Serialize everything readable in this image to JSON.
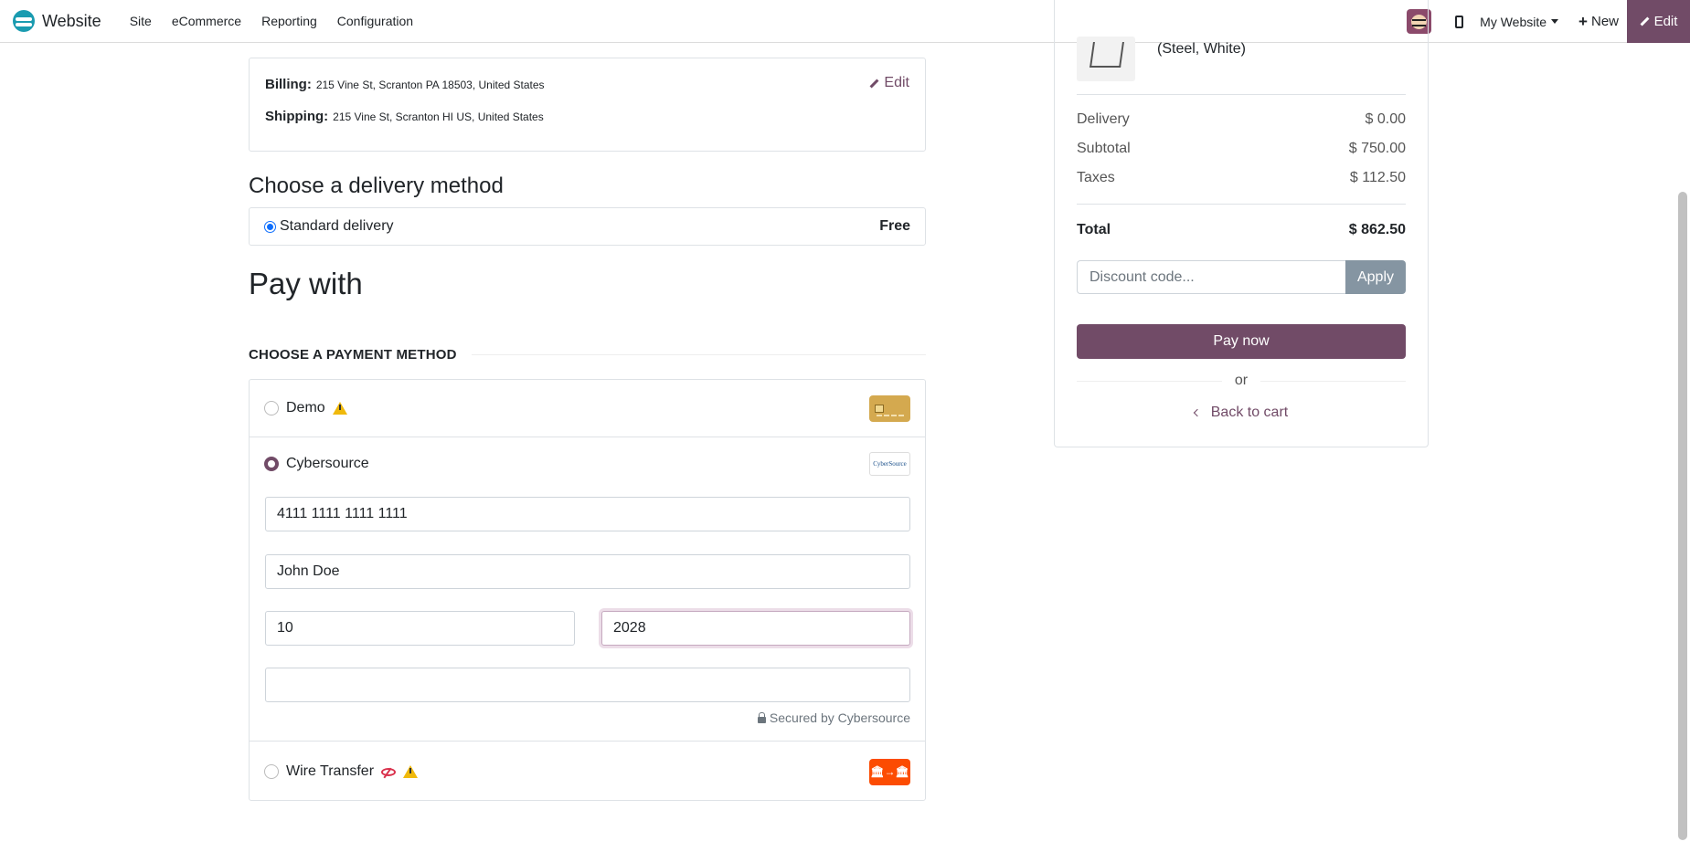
{
  "topbar": {
    "brand": "Website",
    "menu": [
      "Site",
      "eCommerce",
      "Reporting",
      "Configuration"
    ],
    "website_switch": "My Website",
    "new_label": "New",
    "edit_label": "Edit"
  },
  "address": {
    "billing_label": "Billing:",
    "billing_value": "215 Vine St, Scranton PA 18503, United States",
    "shipping_label": "Shipping:",
    "shipping_value": "215 Vine St, Scranton HI US, United States",
    "edit_label": "Edit"
  },
  "delivery": {
    "heading": "Choose a delivery method",
    "option_label": "Standard delivery",
    "option_price": "Free"
  },
  "payment": {
    "title": "Pay with",
    "heading": "CHOOSE A PAYMENT METHOD",
    "methods": [
      {
        "label": "Demo",
        "icon": "card-logo",
        "warning": true
      },
      {
        "label": "Cybersource",
        "icon": "cybersource-logo",
        "selected": true
      },
      {
        "label": "Wire Transfer",
        "icon": "bank-transfer-logo",
        "warning": true,
        "hidden": true
      }
    ],
    "cybersource_logo_text": "CyberSource",
    "wire_logo_text": "🏛→🏛",
    "card_number": "4111 1111 1111 1111",
    "card_holder": "John Doe",
    "exp_month": "10",
    "exp_year": "2028",
    "cvc": "",
    "secured_by": "Secured by Cybersource"
  },
  "summary": {
    "product_variant": "(Steel, White)",
    "delivery_label": "Delivery",
    "delivery_value": "$ 0.00",
    "subtotal_label": "Subtotal",
    "subtotal_value": "$ 750.00",
    "taxes_label": "Taxes",
    "taxes_value": "$ 112.50",
    "total_label": "Total",
    "total_value": "$ 862.50",
    "discount_placeholder": "Discount code...",
    "apply_label": "Apply",
    "pay_now_label": "Pay now",
    "or_label": "or",
    "back_label": "Back to cart"
  },
  "colors": {
    "brand_primary": "#714b67",
    "apply_button": "#8595a2",
    "warning": "#f0b90b",
    "wire_logo": "#fc4c02"
  }
}
